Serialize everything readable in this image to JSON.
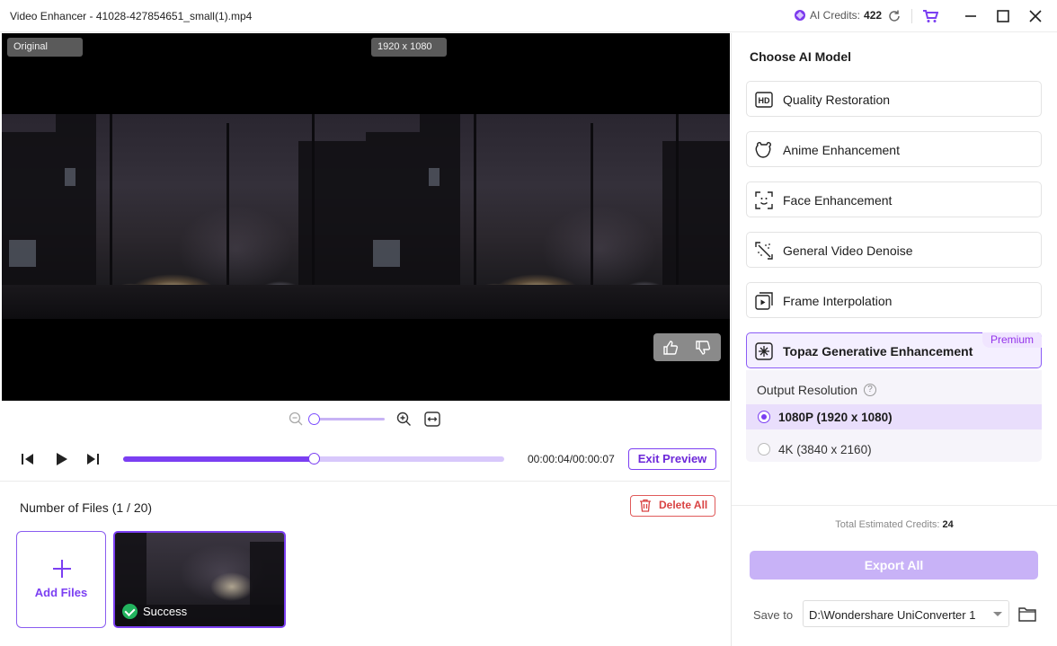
{
  "window": {
    "title": "Video Enhancer - 41028-427854651_small(1).mp4",
    "credits_label": "AI Credits:",
    "credits_value": "422",
    "accent_color": "#7b3ff2"
  },
  "preview": {
    "left_tag": "Original",
    "right_tag": "1920 x 1080",
    "rate_icons": [
      "thumbs-up-icon",
      "thumbs-down-icon"
    ]
  },
  "player": {
    "timecode": "00:00:04/00:00:07",
    "progress": 0.5,
    "zoom_level": 0.0,
    "exit_label": "Exit Preview"
  },
  "files": {
    "count_label": "Number of Files (1 / 20)",
    "delete_label": "Delete All",
    "add_label": "Add Files",
    "items": [
      {
        "status": "Success"
      }
    ]
  },
  "panel": {
    "title": "Choose AI Model",
    "models": [
      {
        "label": "Quality Restoration",
        "icon": "hd-icon"
      },
      {
        "label": "Anime Enhancement",
        "icon": "anime-face-icon"
      },
      {
        "label": "Face Enhancement",
        "icon": "face-scan-icon"
      },
      {
        "label": "General Video Denoise",
        "icon": "denoise-icon"
      },
      {
        "label": "Frame Interpolation",
        "icon": "frame-interpolation-icon"
      },
      {
        "label": "Topaz Generative Enhancement",
        "icon": "sparkle-icon",
        "badge": "Premium",
        "selected": true
      }
    ],
    "resolution_label": "Output Resolution",
    "resolutions": [
      {
        "label": "1080P (1920 x 1080)",
        "selected": true
      },
      {
        "label": "4K (3840 x 2160)",
        "selected": false
      }
    ],
    "estimate_label": "Total Estimated Credits:",
    "estimate_value": "24",
    "export_label": "Export All",
    "save_label": "Save to",
    "save_path": "D:\\Wondershare UniConverter 1"
  }
}
